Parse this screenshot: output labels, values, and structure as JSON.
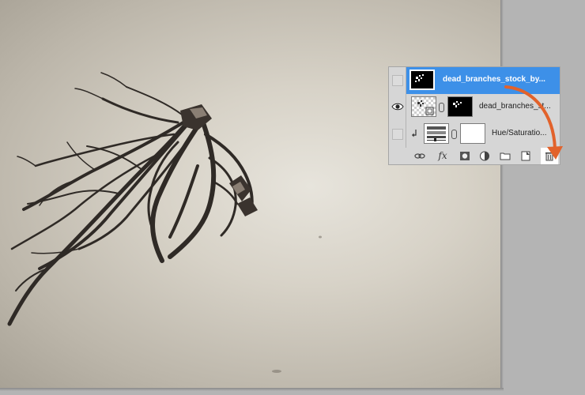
{
  "canvas": {
    "background": "aged paper texture",
    "subject": "dead branches stock image"
  },
  "layers_panel": {
    "layers": [
      {
        "name": "dead_branches_stock_by...",
        "visible": false,
        "selected": true,
        "thumbnail": "black-mask"
      },
      {
        "name": "dead_branches_st...",
        "visible": true,
        "selected": false,
        "thumbnail": "smart-object-with-mask"
      },
      {
        "name": "Hue/Saturatio...",
        "visible": false,
        "selected": false,
        "thumbnail": "adjustment-layer",
        "clipped": true
      }
    ],
    "toolbar": {
      "icons": [
        "link-layers-icon",
        "fx-icon",
        "add-mask-icon",
        "adjustment-icon",
        "new-group-icon",
        "new-layer-icon",
        "trash-icon"
      ],
      "fx_label": "fx"
    }
  },
  "colors": {
    "selection": "#3d90e8",
    "annotation_arrow": "#e2622b"
  }
}
